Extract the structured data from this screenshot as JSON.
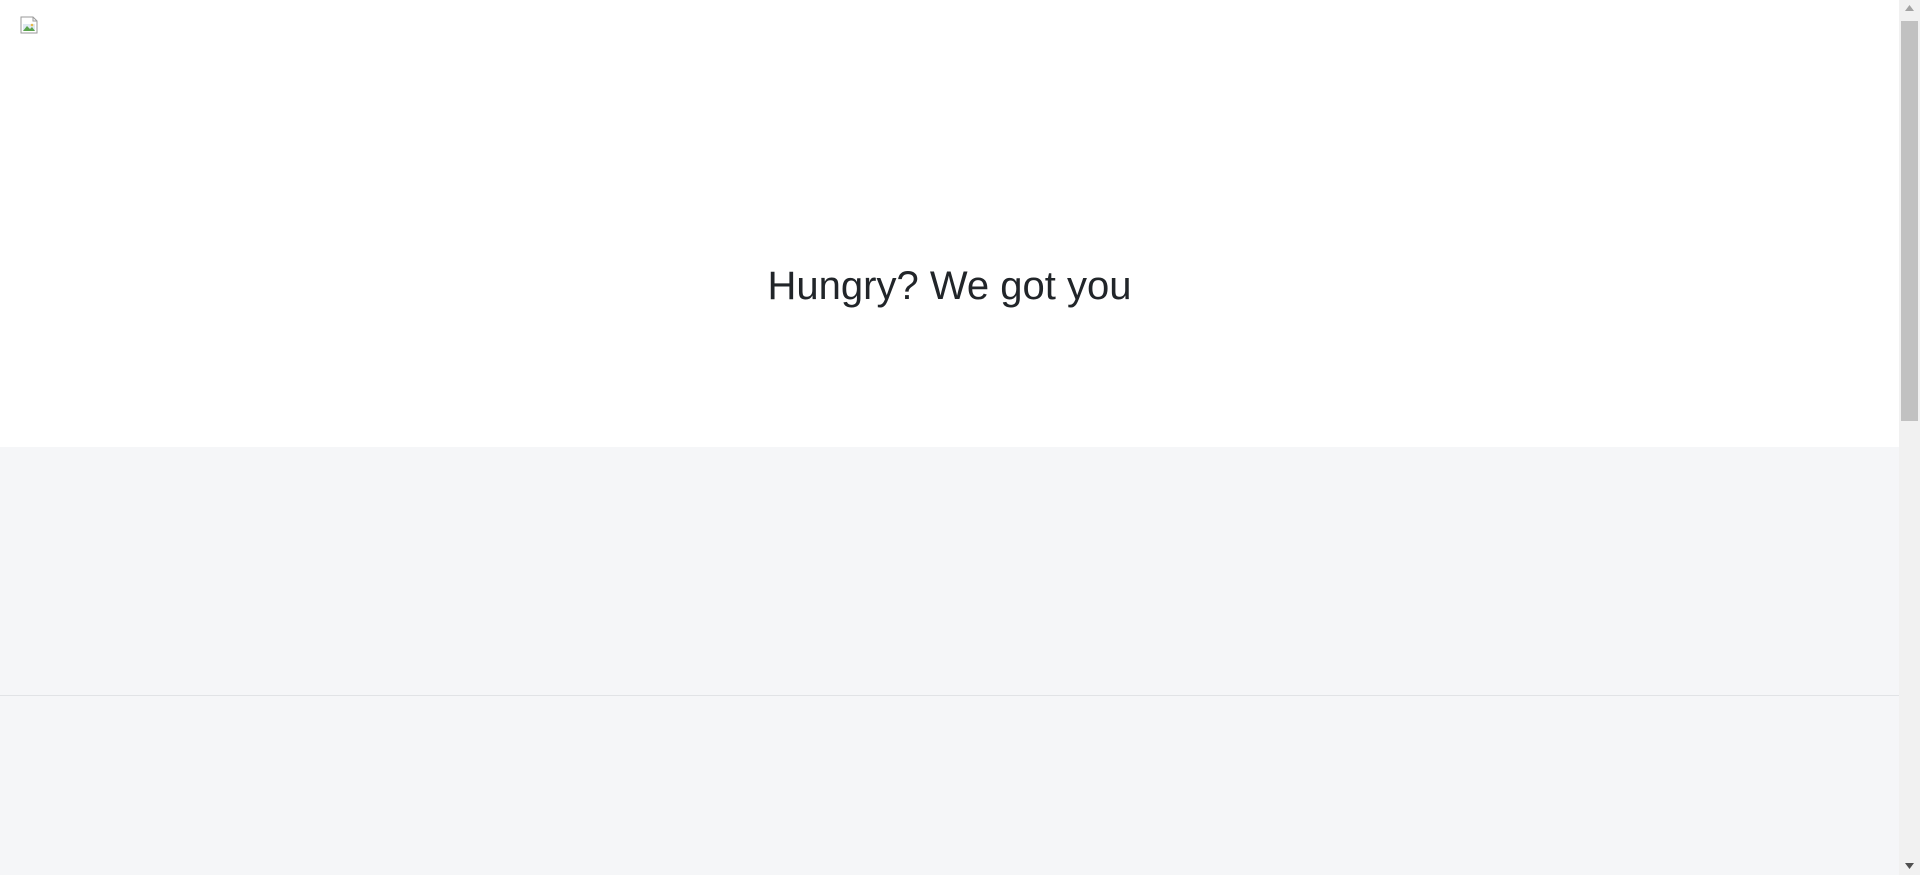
{
  "header": {
    "logo_icon": "broken-image-icon",
    "title": "Hungry? We got you"
  },
  "scrollbar": {
    "up_icon": "arrow-up-icon",
    "down_icon": "arrow-down-icon"
  },
  "colors": {
    "page_background": "#ffffff",
    "section_background": "#f5f6f8",
    "divider": "#e1e3e6",
    "title_text": "#212529",
    "scrollbar_track": "#f1f1f1",
    "scrollbar_thumb": "#c1c1c1"
  }
}
